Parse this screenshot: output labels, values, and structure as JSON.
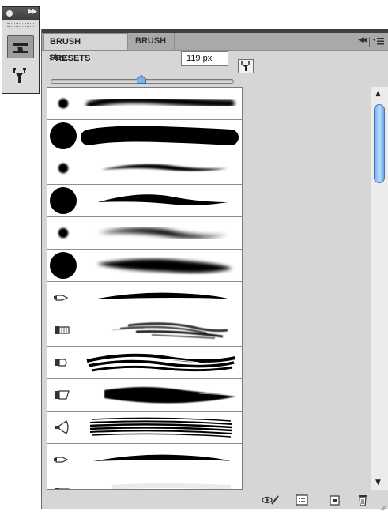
{
  "panel": {
    "tabs": [
      {
        "label": "BRUSH PRESETS",
        "active": true
      },
      {
        "label": "BRUSH",
        "active": false
      }
    ],
    "size_label": "Size:",
    "size_value": "119 px",
    "size_slider_fraction": 0.5
  },
  "dock": {
    "icons": [
      "brush-presets-icon",
      "brush-panel-icon"
    ]
  },
  "presets": [
    {
      "tip": "soft-round",
      "stroke": "soft-wide"
    },
    {
      "tip": "hard-round",
      "stroke": "hard-wide"
    },
    {
      "tip": "soft-round",
      "stroke": "soft-taper"
    },
    {
      "tip": "hard-round",
      "stroke": "hard-taper"
    },
    {
      "tip": "soft-round",
      "stroke": "soft-taper-blur"
    },
    {
      "tip": "hard-round",
      "stroke": "soft-thick"
    },
    {
      "tip": "bristle-round-point",
      "stroke": "thin-taper"
    },
    {
      "tip": "bristle-flat",
      "stroke": "bristle-dry"
    },
    {
      "tip": "bristle-round-blunt",
      "stroke": "bristle-multi"
    },
    {
      "tip": "bristle-angle",
      "stroke": "bristle-thick"
    },
    {
      "tip": "bristle-fan",
      "stroke": "bristle-fan"
    },
    {
      "tip": "bristle-round-point",
      "stroke": "thin-taper"
    },
    {
      "tip": "bristle-flat",
      "stroke": "faint"
    }
  ],
  "scrollbar": {
    "position_fraction": 0.0
  },
  "colors": {
    "panel_bg": "#d6d6d6",
    "tab_bar": "#a9a9a9",
    "scroll_thumb": "#6ea8e6"
  }
}
